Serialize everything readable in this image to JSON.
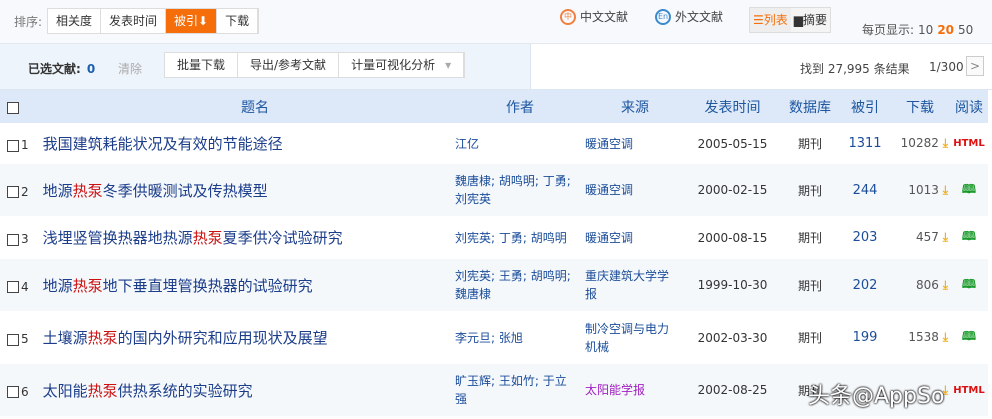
{
  "sort": {
    "label": "排序:",
    "options": [
      "相关度",
      "发表时间",
      "被引",
      "下载"
    ],
    "active": "被引"
  },
  "lang": {
    "zh": "中文文献",
    "en": "外文文献",
    "zh_icon": "中",
    "en_icon": "En"
  },
  "views": {
    "list": "☰列表",
    "abstract": "▆摘要"
  },
  "perpage": {
    "label": "每页显示:",
    "options": [
      "10",
      "20",
      "50"
    ],
    "active": "20"
  },
  "selection": {
    "label": "已选文献:",
    "count": "0",
    "clear": "清除"
  },
  "actions": [
    "批量下载",
    "导出/参考文献",
    "计量可视化分析"
  ],
  "results": {
    "found": "找到 27,995 条结果",
    "page": "1/300",
    "next": ">"
  },
  "columns": [
    "题名",
    "作者",
    "来源",
    "发表时间",
    "数据库",
    "被引",
    "下载",
    "阅读"
  ],
  "rows": [
    {
      "n": "1",
      "title": [
        "我国建筑耗能状况及有效的节能途径"
      ],
      "author": "江亿",
      "source": "暖通空调",
      "date": "2005-05-15",
      "db": "期刊",
      "cite": "1311",
      "dl": "10282",
      "read": "HTML"
    },
    {
      "n": "2",
      "title": [
        "地源",
        "热泵",
        "冬季供暖测试及传热模型"
      ],
      "author": "魏唐棣; 胡鸣明; 丁勇; 刘宪英",
      "source": "暖通空调",
      "date": "2000-02-15",
      "db": "期刊",
      "cite": "244",
      "dl": "1013",
      "read": "book"
    },
    {
      "n": "3",
      "title": [
        "浅埋竖管换热器地热源",
        "热泵",
        "夏季供冷试验研究"
      ],
      "author": "刘宪英; 丁勇; 胡鸣明",
      "source": "暖通空调",
      "date": "2000-08-15",
      "db": "期刊",
      "cite": "203",
      "dl": "457",
      "read": "book"
    },
    {
      "n": "4",
      "title": [
        "地源",
        "热泵",
        "地下垂直埋管换热器的试验研究"
      ],
      "author": "刘宪英; 王勇; 胡鸣明; 魏唐棣",
      "source": "重庆建筑大学学报",
      "date": "1999-10-30",
      "db": "期刊",
      "cite": "202",
      "dl": "806",
      "read": "book"
    },
    {
      "n": "5",
      "title": [
        "土壤源",
        "热泵",
        "的国内外研究和应用现状及展望"
      ],
      "author": "李元旦; 张旭",
      "source": "制冷空调与电力机械",
      "date": "2002-03-30",
      "db": "期刊",
      "cite": "199",
      "dl": "1538",
      "read": "book"
    },
    {
      "n": "6",
      "title": [
        "太阳能",
        "热泵",
        "供热系统的实验研究"
      ],
      "author": "旷玉辉; 王如竹; 于立强",
      "source": "太阳能学报",
      "date": "2002-08-25",
      "db": "期刊",
      "cite": "",
      "dl": "",
      "read": "HTML"
    }
  ],
  "watermark": "头条@AppSo"
}
